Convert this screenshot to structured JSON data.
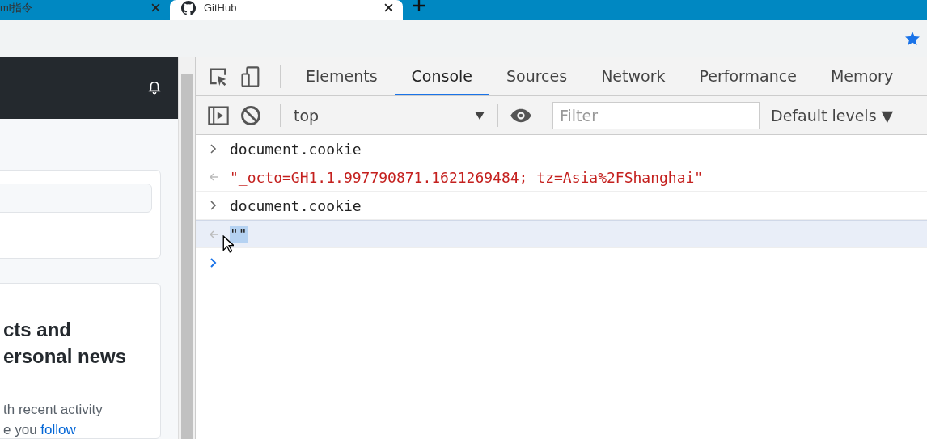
{
  "browser_tabs": [
    {
      "title": "ml指令",
      "selected": false,
      "favicon": false
    },
    {
      "title": "GitHub",
      "selected": true,
      "favicon": true
    }
  ],
  "page": {
    "heading_lines": [
      "cts and",
      "ersonal news"
    ],
    "body_lines": [
      "th recent activity"
    ],
    "last_line": {
      "text": "e you ",
      "link": "follow"
    }
  },
  "devtools": {
    "tabs": [
      {
        "label": "Elements",
        "selected": false
      },
      {
        "label": "Console",
        "selected": true
      },
      {
        "label": "Sources",
        "selected": false
      },
      {
        "label": "Network",
        "selected": false
      },
      {
        "label": "Performance",
        "selected": false
      },
      {
        "label": "Memory",
        "selected": false
      }
    ],
    "context": "top",
    "filter_placeholder": "Filter",
    "levels": "Default levels ▼",
    "console": [
      {
        "kind": "input",
        "text": "document.cookie",
        "selected": false
      },
      {
        "kind": "output",
        "text": "\"_octo=GH1.1.997790871.1621269484; tz=Asia%2FShanghai\"",
        "selected": false
      },
      {
        "kind": "input",
        "text": "document.cookie",
        "selected": false
      },
      {
        "kind": "output",
        "text": "\"\"",
        "selected": true
      },
      {
        "kind": "prompt",
        "selected": false
      }
    ]
  }
}
